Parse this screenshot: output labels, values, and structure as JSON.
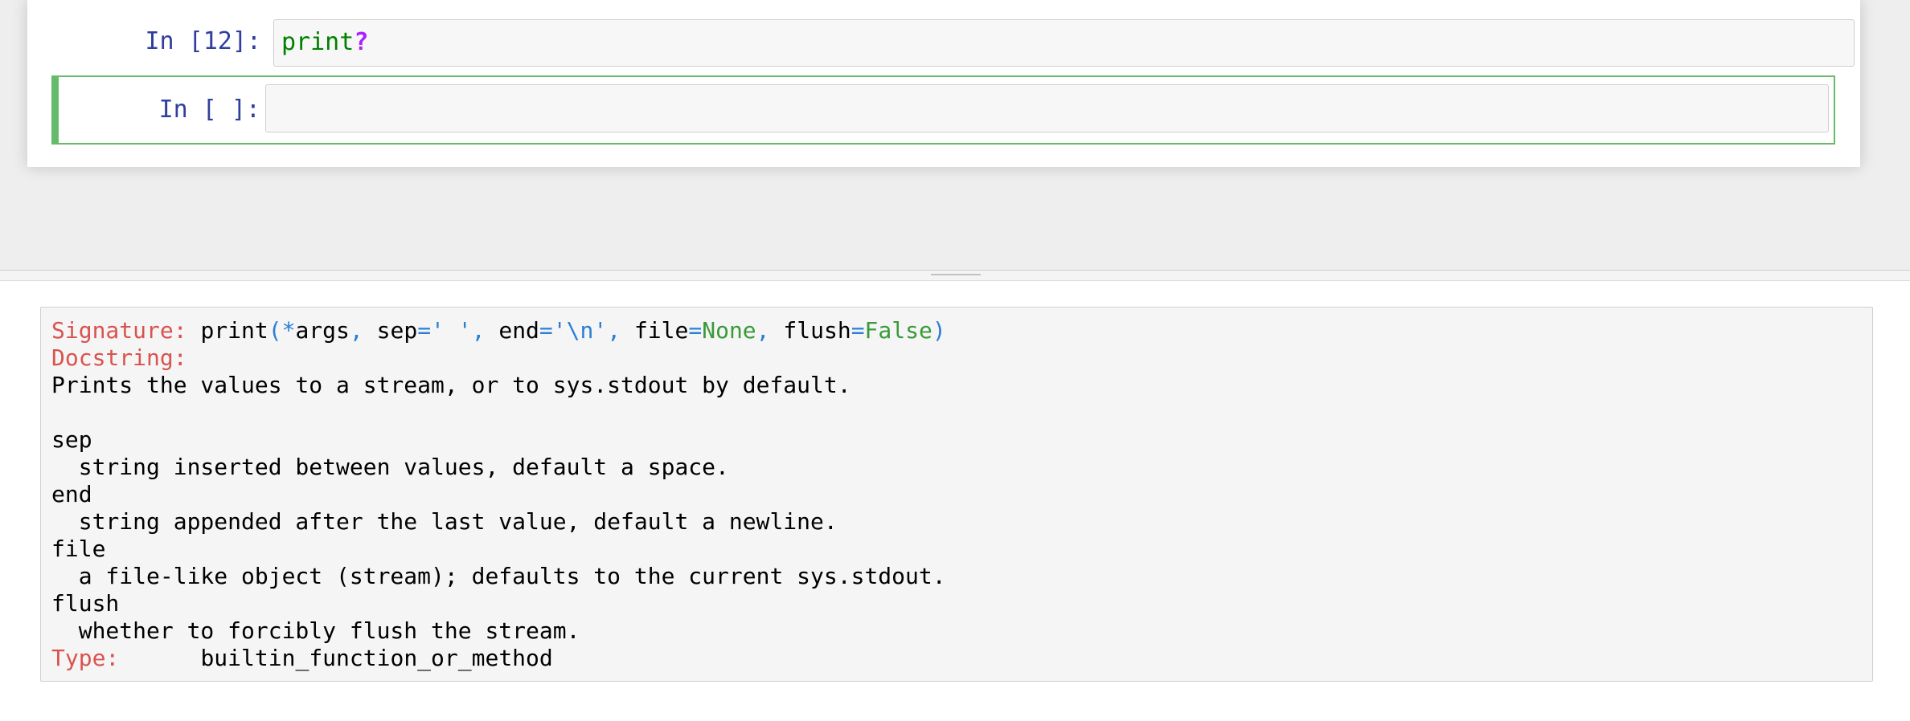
{
  "cells": [
    {
      "prompt": "In [12]:",
      "code_name": "print",
      "code_op": "?"
    },
    {
      "prompt": "In [ ]:",
      "code": ""
    }
  ],
  "pager": {
    "signature_label": "Signature:",
    "signature": {
      "func": "print",
      "open_paren": "(",
      "star": "*",
      "arg1": "args",
      "comma1": ", ",
      "sep_name": "sep",
      "sep_eq": "=",
      "sep_val": "' '",
      "comma2": ", ",
      "end_name": "end",
      "end_eq": "=",
      "end_val": "'\\n'",
      "comma3": ", ",
      "file_name": "file",
      "file_eq": "=",
      "file_val": "None",
      "comma4": ", ",
      "flush_name": "flush",
      "flush_eq": "=",
      "flush_val": "False",
      "close_paren": ")"
    },
    "docstring_label": "Docstring:",
    "doc_lines": [
      "Prints the values to a stream, or to sys.stdout by default.",
      "",
      "sep",
      "  string inserted between values, default a space.",
      "end",
      "  string appended after the last value, default a newline.",
      "file",
      "  a file-like object (stream); defaults to the current sys.stdout.",
      "flush",
      "  whether to forcibly flush the stream."
    ],
    "type_label": "Type:",
    "type_value": "builtin_function_or_method"
  },
  "colors": {
    "prompt": "#303f9f",
    "selected_cell_border": "#66bb6a",
    "header_red": "#d9534f",
    "code_name_green": "#008000",
    "code_op_purple": "#aa22ff"
  }
}
